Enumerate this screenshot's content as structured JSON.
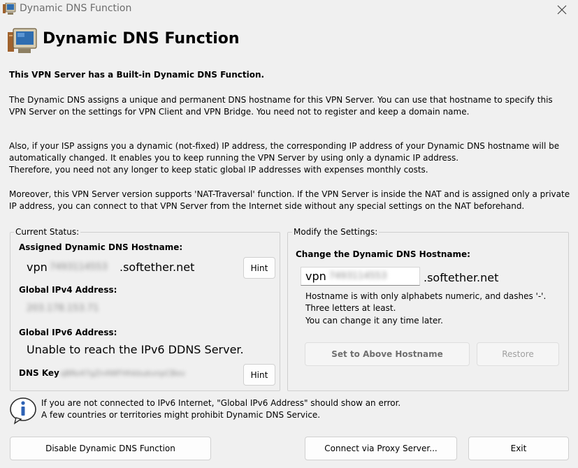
{
  "window": {
    "title": "Dynamic DNS Function",
    "close_glyph": "✕"
  },
  "header": {
    "title": "Dynamic DNS Function"
  },
  "intro": {
    "bold_line": "This VPN Server has a Built-in Dynamic DNS Function.",
    "p1": "The Dynamic DNS assigns a unique and permanent DNS hostname for this VPN Server. You can use that hostname to specify this VPN Server on the settings for VPN Client and VPN Bridge. You need not to register and keep a domain name.",
    "p2a": "Also, if your ISP assigns you a dynamic (not-fixed) IP address, the corresponding IP address of your Dynamic DNS hostname will be automatically changed. It enables you to keep running the VPN Server by using only a dynamic IP address.",
    "p2b": "Therefore, you need not any longer to keep static global IP addresses with expenses monthly costs.",
    "p3": "Moreover, this VPN Server version supports 'NAT-Traversal' function. If the VPN Server is inside the NAT and is assigned only a private IP address, you can connect to that VPN Server from the Internet side without any special settings on the NAT beforehand."
  },
  "status": {
    "group_label": "Current Status:",
    "hostname_label": "Assigned Dynamic DNS Hostname:",
    "hostname_prefix": "vpn",
    "hostname_blurred": "7493114553",
    "hostname_suffix": ".softether.net",
    "hint_label": "Hint",
    "ipv4_label": "Global IPv4 Address:",
    "ipv4_blurred": "203.178.153.71",
    "ipv6_label": "Global IPv6 Address:",
    "ipv6_value": "Unable to reach the IPv6 DDNS Server.",
    "dnskey_label": "DNS Key",
    "dnskey_blurred": "qBRo47gZn4WFHhkbukvnpCBev",
    "hint2_label": "Hint"
  },
  "modify": {
    "group_label": "Modify the Settings:",
    "change_label": "Change the Dynamic DNS Hostname:",
    "input_prefix": "vpn",
    "input_blurred": "7493114553",
    "suffix": ".softether.net",
    "rule1": "Hostname is with only alphabets numeric, and dashes '-'.",
    "rule2": "Three letters at least.",
    "rule3": "You can change it any time later.",
    "set_button": "Set to Above Hostname",
    "restore_button": "Restore"
  },
  "notice": {
    "line1": "If you are not connected to IPv6 Internet, \"Global IPv6 Address\" should show an error.",
    "line2": "A few countries or territories might prohibit Dynamic DNS Service."
  },
  "footer": {
    "disable_button": "Disable Dynamic DNS Function",
    "proxy_button": "Connect via Proxy Server...",
    "exit_button": "Exit"
  }
}
